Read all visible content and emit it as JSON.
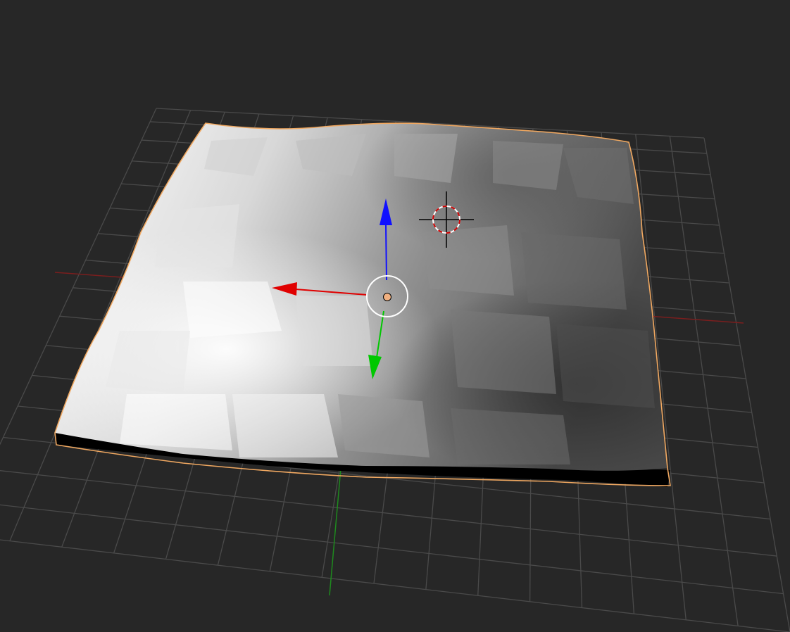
{
  "viewport": {
    "background": "#272727",
    "grid_color": "#4a4a4a",
    "axis_x_color": "#7a1e1e",
    "axis_y_color": "#1e8a1e"
  },
  "object": {
    "selection_outline_color": "#f0a861",
    "surface_light": "#f2f2f2",
    "surface_dark": "#3a3a3a",
    "base_color": "#000000"
  },
  "gizmo": {
    "x_arrow_color": "#e00000",
    "y_arrow_color": "#00c800",
    "z_arrow_color": "#1010ff",
    "origin_color": "#f0b080",
    "ring_color": "#ffffff"
  },
  "cursor_3d": {
    "ring_red": "#d00000",
    "ring_white": "#ffffff",
    "crosshair_color": "#000000"
  }
}
